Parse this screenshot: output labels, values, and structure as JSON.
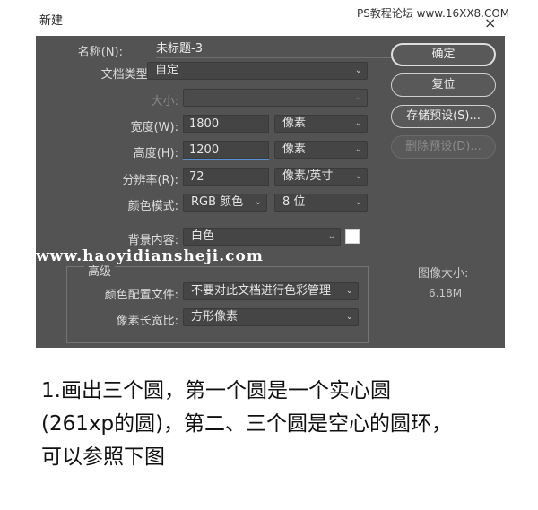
{
  "window": {
    "title": "新建",
    "watermark": "PS教程论坛 www.16XX8.COM",
    "close_glyph": "×"
  },
  "dialog": {
    "name_label": "名称(N):",
    "name_value": "未标题-3",
    "doc_type_label": "文档类型:",
    "doc_type_value": "自定",
    "size_label": "大小:",
    "size_value": "",
    "width_label": "宽度(W):",
    "width_value": "1800",
    "width_unit": "像素",
    "height_label": "高度(H):",
    "height_value": "1200",
    "height_unit": "像素",
    "resolution_label": "分辨率(R):",
    "resolution_value": "72",
    "resolution_unit": "像素/英寸",
    "color_mode_label": "颜色模式:",
    "color_mode_value": "RGB 颜色",
    "bit_depth_value": "8 位",
    "background_label": "背景内容:",
    "background_value": "白色",
    "advanced_label": "高级",
    "color_profile_label": "颜色配置文件:",
    "color_profile_value": "不要对此文档进行色彩管理",
    "pixel_aspect_label": "像素长宽比:",
    "pixel_aspect_value": "方形像素",
    "image_size_label": "图像大小:",
    "image_size_value": "6.18M",
    "watermark": "www.haoyidiansheji.com"
  },
  "buttons": {
    "ok": "确定",
    "reset": "复位",
    "save_preset": "存储预设(S)...",
    "delete_preset": "删除预设(D)..."
  },
  "caption": {
    "line1": "1.画出三个圆，第一个圆是一个实心圆",
    "line2": "(261xp的圆)，第二、三个圆是空心的圆环，",
    "line3": "可以参照下图"
  },
  "colors": {
    "dialog_bg": "#535353",
    "field_bg": "#444444",
    "focus_underline": "#5b8fd6"
  }
}
